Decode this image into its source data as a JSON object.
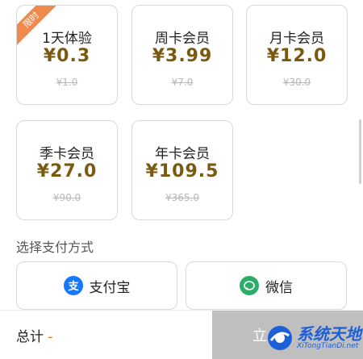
{
  "plans": [
    {
      "name": "1天体验",
      "price": "¥0.3",
      "original": "¥1.0",
      "badge": "限时"
    },
    {
      "name": "周卡会员",
      "price": "¥3.99",
      "original": "¥7.0"
    },
    {
      "name": "月卡会员",
      "price": "¥12.0",
      "original": "¥30.0"
    },
    {
      "name": "季卡会员",
      "price": "¥27.0",
      "original": "¥90.0"
    },
    {
      "name": "年卡会员",
      "price": "¥109.5",
      "original": "¥365.0"
    }
  ],
  "payment": {
    "section_title": "选择支付方式",
    "options": [
      {
        "label": "支付宝",
        "icon": "alipay-icon",
        "color": "#1677ff"
      },
      {
        "label": "微信",
        "icon": "wechat-icon",
        "color": "#2aae67"
      }
    ]
  },
  "footer": {
    "total_label": "总计",
    "total_value": "-",
    "pay_button": "立"
  },
  "watermark": {
    "cn": "系统天地",
    "en": "XiTongTianDi.net"
  },
  "colors": {
    "price": "#7a5a10",
    "badge": "#f08a4a",
    "button_disabled": "#bfbfbf"
  }
}
